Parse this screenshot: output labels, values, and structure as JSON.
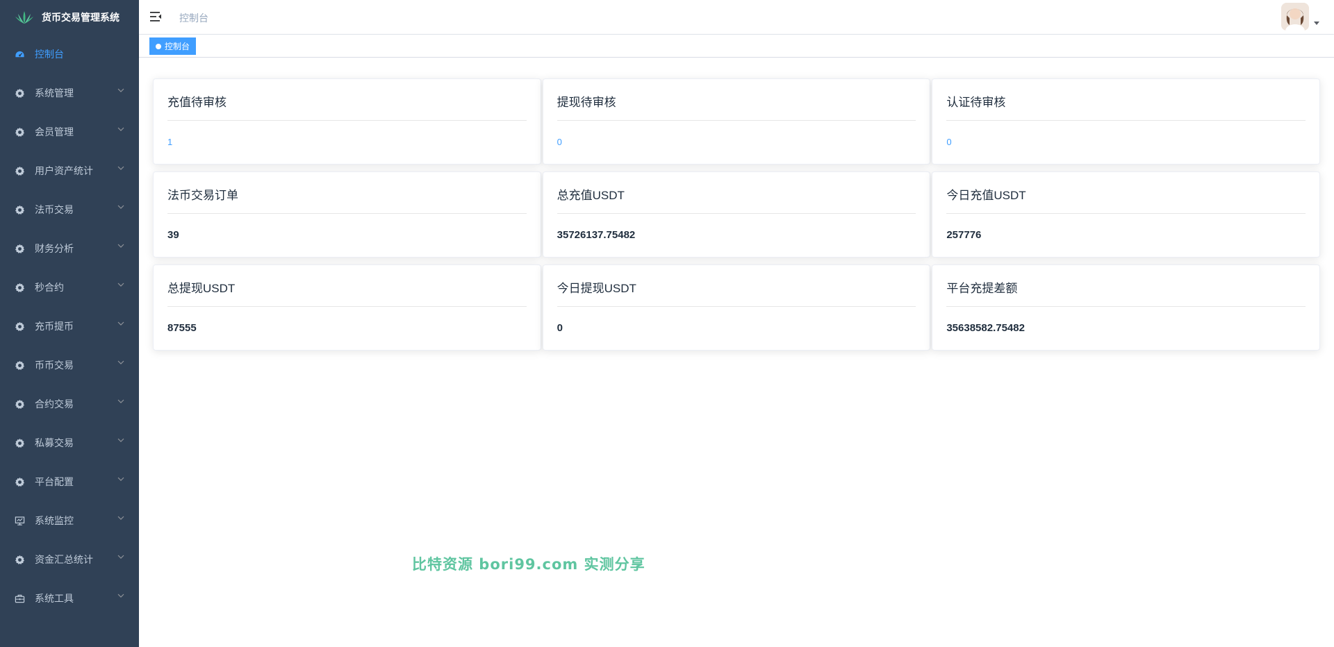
{
  "app": {
    "title": "货币交易管理系统"
  },
  "sidebar": {
    "items": [
      {
        "label": "控制台",
        "icon": "dashboard-icon",
        "active": true
      },
      {
        "label": "系统管理",
        "icon": "gear-icon"
      },
      {
        "label": "会员管理",
        "icon": "gear-icon"
      },
      {
        "label": "用户资产统计",
        "icon": "gear-icon"
      },
      {
        "label": "法币交易",
        "icon": "gear-icon"
      },
      {
        "label": "财务分析",
        "icon": "gear-icon"
      },
      {
        "label": "秒合约",
        "icon": "gear-icon"
      },
      {
        "label": "充币提币",
        "icon": "gear-icon"
      },
      {
        "label": "币币交易",
        "icon": "gear-icon"
      },
      {
        "label": "合约交易",
        "icon": "gear-icon"
      },
      {
        "label": "私募交易",
        "icon": "gear-icon"
      },
      {
        "label": "平台配置",
        "icon": "gear-icon"
      },
      {
        "label": "系统监控",
        "icon": "monitor-icon"
      },
      {
        "label": "资金汇总统计",
        "icon": "gear-icon"
      },
      {
        "label": "系统工具",
        "icon": "toolbox-icon"
      }
    ]
  },
  "navbar": {
    "breadcrumb": "控制台"
  },
  "tags": {
    "active_tag": "控制台"
  },
  "stats": [
    {
      "title": "充值待审核",
      "value": "1",
      "style": "link"
    },
    {
      "title": "提现待审核",
      "value": "0",
      "style": "link"
    },
    {
      "title": "认证待审核",
      "value": "0",
      "style": "link"
    },
    {
      "title": "法币交易订单",
      "value": "39",
      "style": "bold"
    },
    {
      "title": "总充值USDT",
      "value": "35726137.75482",
      "style": "bold"
    },
    {
      "title": "今日充值USDT",
      "value": "257776",
      "style": "bold"
    },
    {
      "title": "总提现USDT",
      "value": "87555",
      "style": "bold"
    },
    {
      "title": "今日提现USDT",
      "value": "0",
      "style": "bold"
    },
    {
      "title": "平台充提差额",
      "value": "35638582.75482",
      "style": "bold"
    }
  ],
  "watermark": "比特资源 bori99.com 实测分享",
  "colors": {
    "sidebar_bg": "#304156",
    "sidebar_text": "#bfcbd9",
    "accent": "#409eff",
    "watermark": "#5fc5a0"
  }
}
